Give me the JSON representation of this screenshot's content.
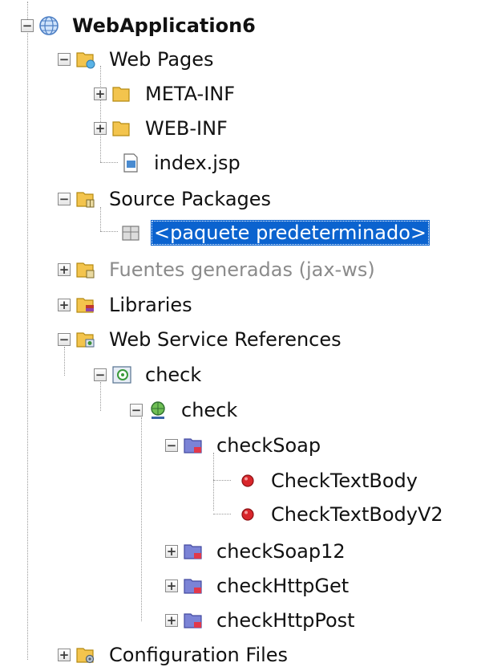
{
  "tree": {
    "root": {
      "label": "WebApplication6",
      "icon": "web-globe-icon"
    },
    "web_pages": {
      "label": "Web Pages",
      "icon": "web-pages-folder-icon",
      "children": [
        {
          "label": "META-INF",
          "icon": "folder-icon"
        },
        {
          "label": "WEB-INF",
          "icon": "folder-icon"
        },
        {
          "label": "index.jsp",
          "icon": "jsp-file-icon"
        }
      ]
    },
    "source_packages": {
      "label": "Source Packages",
      "icon": "source-packages-folder-icon",
      "children": [
        {
          "label": "<paquete predeterminado>",
          "icon": "package-icon",
          "selected": true
        }
      ]
    },
    "generated_sources": {
      "label": "Fuentes generadas (jax-ws)",
      "icon": "generated-sources-folder-icon"
    },
    "libraries": {
      "label": "Libraries",
      "icon": "libraries-folder-icon"
    },
    "ws_references": {
      "label": "Web Service References",
      "icon": "web-service-references-folder-icon",
      "service": {
        "label": "check",
        "icon": "web-service-icon",
        "port_service": {
          "label": "check",
          "icon": "web-service-node-icon",
          "ports": [
            {
              "label": "checkSoap",
              "icon": "port-folder-icon",
              "operations": [
                {
                  "label": "CheckTextBody",
                  "icon": "operation-icon"
                },
                {
                  "label": "CheckTextBodyV2",
                  "icon": "operation-icon"
                }
              ]
            },
            {
              "label": "checkSoap12",
              "icon": "port-folder-icon"
            },
            {
              "label": "checkHttpGet",
              "icon": "port-folder-icon"
            },
            {
              "label": "checkHttpPost",
              "icon": "port-folder-icon"
            }
          ]
        }
      }
    },
    "config_files": {
      "label": "Configuration Files",
      "icon": "configuration-files-folder-icon"
    }
  },
  "toggle_symbols": {
    "expanded": "−",
    "collapsed": "+"
  },
  "colors": {
    "selection": "#0b63cf",
    "folder": "#f3c44d",
    "port_folder": "#7b83d6",
    "operation": "#d9262b"
  }
}
